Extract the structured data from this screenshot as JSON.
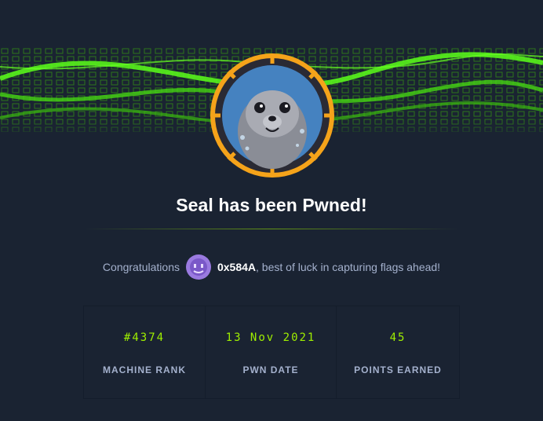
{
  "header": {
    "title": "Seal has been Pwned!"
  },
  "congrats": {
    "prefix": "Congratulations",
    "username": "0x584A",
    "suffix": ", best of luck in capturing flags ahead!"
  },
  "stats": [
    {
      "value": "#4374",
      "label": "MACHINE RANK"
    },
    {
      "value": "13 Nov 2021",
      "label": "PWN DATE"
    },
    {
      "value": "45",
      "label": "POINTS EARNED"
    }
  ],
  "colors": {
    "background": "#1a2332",
    "accent_green": "#9fef00",
    "badge_orange": "#f5a31a",
    "muted_text": "#a4b1cd",
    "avatar_purple": "#9a7ae0"
  },
  "icons": {
    "machine_badge": "seal-machine-avatar-icon",
    "user_avatar": "user-avatar-icon"
  }
}
